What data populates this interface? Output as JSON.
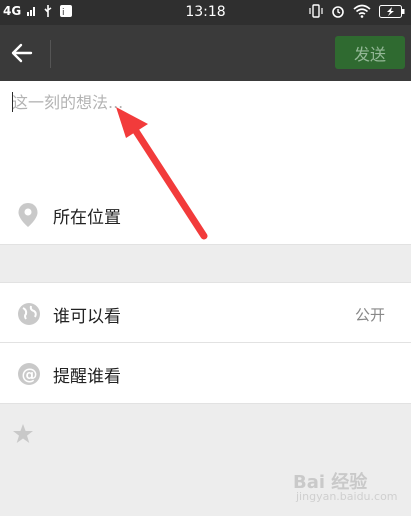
{
  "status_bar": {
    "network": "4G",
    "time": "13:18",
    "icons": [
      "signal-icon",
      "usb-icon",
      "notification-icon",
      "vibrate-icon",
      "alarm-icon",
      "wifi-icon",
      "battery-charging-icon"
    ]
  },
  "toolbar": {
    "back_icon": "arrow-left-icon",
    "send_label": "发送",
    "send_color": "#2f6a30"
  },
  "compose": {
    "placeholder": "这一刻的想法..."
  },
  "location": {
    "icon": "location-pin-icon",
    "label": "所在位置"
  },
  "settings": {
    "visibility": {
      "icon": "globe-icon",
      "label": "谁可以看",
      "value": "公开"
    },
    "mention": {
      "icon": "at-icon",
      "label": "提醒谁看"
    }
  },
  "extra": {
    "icon": "star-icon"
  },
  "annotation": {
    "arrow_color": "#f23b3b"
  },
  "watermark": {
    "text": "Bai 经验",
    "subtext": "jingyan.baidu.com"
  }
}
